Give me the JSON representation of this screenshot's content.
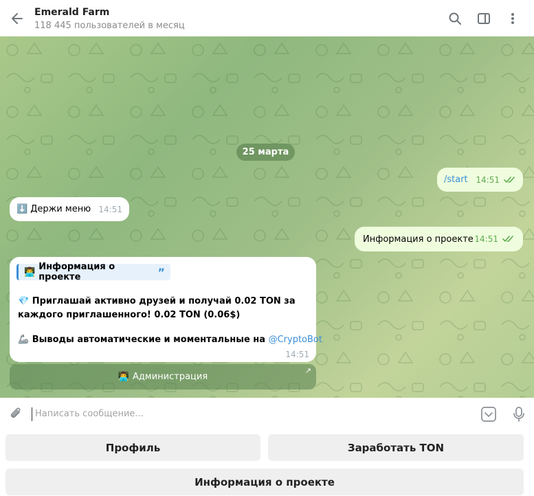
{
  "header": {
    "title": "Emerald Farm",
    "subtitle": "118 445 пользователей в месяц"
  },
  "chat": {
    "date": "25 марта",
    "messages": {
      "start": {
        "text": "/start",
        "time": "14:51"
      },
      "menu": {
        "emoji": "⬇️",
        "text": "Держи меню",
        "time": "14:51"
      },
      "info_out": {
        "text": "Информация о проекте",
        "time": "14:51"
      },
      "info_in": {
        "quote_emoji": "👨‍💻",
        "quote": "Информация о проекте",
        "line1_emoji": "💎",
        "line1": "Приглашай активно друзей и получай 0.02 TON за каждого приглашенного! 0.02 TON (0.06$)",
        "line2_emoji": "🦾",
        "line2_prefix": "Выводы автоматические и моментальные на ",
        "line2_link": "@CryptoBot",
        "time": "14:51"
      }
    },
    "inline_button": {
      "emoji": "👨‍💻",
      "label": "Администрация"
    }
  },
  "composer": {
    "placeholder": "Написать сообщение..."
  },
  "keyboard": {
    "profile": "Профиль",
    "earn": "Заработать TON",
    "info": "Информация о проекте"
  },
  "colors": {
    "outgoing_bubble": "#effdde",
    "link": "#3a8fd8",
    "check": "#5dac4e"
  }
}
